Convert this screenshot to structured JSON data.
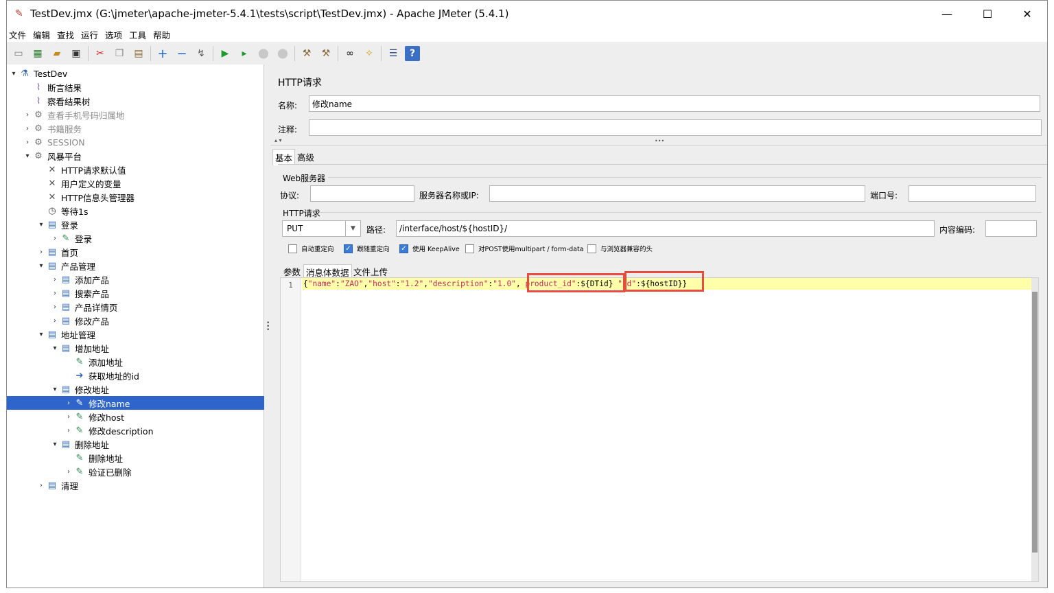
{
  "window": {
    "title": "TestDev.jmx (G:\\jmeter\\apache-jmeter-5.4.1\\tests\\script\\TestDev.jmx) - Apache JMeter (5.4.1)",
    "minimize": "—",
    "maximize": "☐",
    "close": "✕"
  },
  "menu": [
    "文件",
    "编辑",
    "查找",
    "运行",
    "选项",
    "工具",
    "帮助"
  ],
  "toolbar_icons": [
    "new-icon",
    "templates-icon",
    "open-icon",
    "save-icon",
    "cut-icon",
    "copy-icon",
    "paste-icon",
    "expand-icon",
    "collapse-icon",
    "toggle-icon",
    "start-icon",
    "start-no-pause-icon",
    "stop-icon",
    "shutdown-icon",
    "clear-icon",
    "clear-all-icon",
    "search-icon",
    "reset-search-icon",
    "function-helper-icon",
    "help-icon"
  ],
  "tree": [
    {
      "label": "TestDev",
      "level": 0,
      "toggle": "▾",
      "icon": "test-plan-icon"
    },
    {
      "label": "断言结果",
      "level": 1,
      "toggle": "",
      "icon": "listener-icon"
    },
    {
      "label": "察看结果树",
      "level": 1,
      "toggle": "",
      "icon": "listener-icon"
    },
    {
      "label": "查看手机号码归属地",
      "level": 1,
      "toggle": "›",
      "icon": "thread-group-icon",
      "disabled": true
    },
    {
      "label": "书籍服务",
      "level": 1,
      "toggle": "›",
      "icon": "thread-group-icon",
      "disabled": true
    },
    {
      "label": "SESSION",
      "level": 1,
      "toggle": "›",
      "icon": "thread-group-icon",
      "disabled": true
    },
    {
      "label": "风暴平台",
      "level": 1,
      "toggle": "▾",
      "icon": "thread-group-icon"
    },
    {
      "label": "HTTP请求默认值",
      "level": 2,
      "toggle": "",
      "icon": "config-icon"
    },
    {
      "label": "用户定义的变量",
      "level": 2,
      "toggle": "",
      "icon": "config-icon"
    },
    {
      "label": "HTTP信息头管理器",
      "level": 2,
      "toggle": "",
      "icon": "config-icon"
    },
    {
      "label": "等待1s",
      "level": 2,
      "toggle": "",
      "icon": "timer-icon"
    },
    {
      "label": "登录",
      "level": 2,
      "toggle": "▾",
      "icon": "controller-icon"
    },
    {
      "label": "登录",
      "level": 3,
      "toggle": "›",
      "icon": "sampler-icon"
    },
    {
      "label": "首页",
      "level": 2,
      "toggle": "›",
      "icon": "controller-icon"
    },
    {
      "label": "产品管理",
      "level": 2,
      "toggle": "▾",
      "icon": "controller-icon"
    },
    {
      "label": "添加产品",
      "level": 3,
      "toggle": "›",
      "icon": "controller-icon"
    },
    {
      "label": "搜索产品",
      "level": 3,
      "toggle": "›",
      "icon": "controller-icon"
    },
    {
      "label": "产品详情页",
      "level": 3,
      "toggle": "›",
      "icon": "controller-icon"
    },
    {
      "label": "修改产品",
      "level": 3,
      "toggle": "›",
      "icon": "controller-icon"
    },
    {
      "label": "地址管理",
      "level": 2,
      "toggle": "▾",
      "icon": "controller-icon"
    },
    {
      "label": "增加地址",
      "level": 3,
      "toggle": "▾",
      "icon": "controller-icon"
    },
    {
      "label": "添加地址",
      "level": 4,
      "toggle": "",
      "icon": "sampler-icon"
    },
    {
      "label": "获取地址的id",
      "level": 4,
      "toggle": "",
      "icon": "extractor-icon"
    },
    {
      "label": "修改地址",
      "level": 3,
      "toggle": "▾",
      "icon": "controller-icon"
    },
    {
      "label": "修改name",
      "level": 4,
      "toggle": "›",
      "icon": "sampler-icon",
      "selected": true
    },
    {
      "label": "修改host",
      "level": 4,
      "toggle": "›",
      "icon": "sampler-icon"
    },
    {
      "label": "修改description",
      "level": 4,
      "toggle": "›",
      "icon": "sampler-icon"
    },
    {
      "label": "删除地址",
      "level": 3,
      "toggle": "▾",
      "icon": "controller-icon"
    },
    {
      "label": "删除地址",
      "level": 4,
      "toggle": "",
      "icon": "sampler-icon"
    },
    {
      "label": "验证已删除",
      "level": 4,
      "toggle": "›",
      "icon": "sampler-icon"
    },
    {
      "label": "清理",
      "level": 2,
      "toggle": "›",
      "icon": "controller-icon"
    }
  ],
  "panel": {
    "heading": "HTTP请求",
    "name_label": "名称:",
    "name_value": "修改name",
    "comment_label": "注释:",
    "comment_value": "",
    "collapse_arrows": "▴ ▾",
    "grip": "•••",
    "tabs": [
      "基本",
      "高级"
    ],
    "web_server_title": "Web服务器",
    "protocol_label": "协议:",
    "protocol_value": "",
    "server_label": "服务器名称或IP:",
    "server_value": "",
    "port_label": "端口号:",
    "port_value": "",
    "http_title": "HTTP请求",
    "method": "PUT",
    "path_label": "路径:",
    "path_value": "/interface/host/${hostID}/",
    "encoding_label": "内容编码:",
    "encoding_value": "",
    "checkboxes": [
      {
        "label": "自动重定向",
        "checked": false
      },
      {
        "label": "跟随重定向",
        "checked": true
      },
      {
        "label": "使用 KeepAlive",
        "checked": true
      },
      {
        "label": "对POST使用multipart / form-data",
        "checked": false
      },
      {
        "label": "与浏览器兼容的头",
        "checked": false
      }
    ],
    "body_tabs": [
      "参数",
      "消息体数据",
      "文件上传"
    ],
    "line_number": "1",
    "body_code": [
      {
        "t": "{",
        "c": "p"
      },
      {
        "t": "\"name\"",
        "c": "s"
      },
      {
        "t": ":",
        "c": "p"
      },
      {
        "t": "\"ZAO\"",
        "c": "s"
      },
      {
        "t": ",",
        "c": "p"
      },
      {
        "t": "\"host\"",
        "c": "s"
      },
      {
        "t": ":",
        "c": "p"
      },
      {
        "t": "\"1.2\"",
        "c": "s"
      },
      {
        "t": ",",
        "c": "p"
      },
      {
        "t": "\"description\"",
        "c": "s"
      },
      {
        "t": ":",
        "c": "p"
      },
      {
        "t": "\"1.0\"",
        "c": "s"
      },
      {
        "t": ", ",
        "c": "p"
      },
      {
        "t": "product_id\"",
        "c": "s"
      },
      {
        "t": ":${DTid}",
        "c": "p"
      },
      {
        "t": " ",
        "c": "p"
      },
      {
        "t": "\"id\"",
        "c": "s"
      },
      {
        "t": ":${hostID}",
        "c": "p"
      },
      {
        "t": "}",
        "c": "p"
      }
    ]
  }
}
